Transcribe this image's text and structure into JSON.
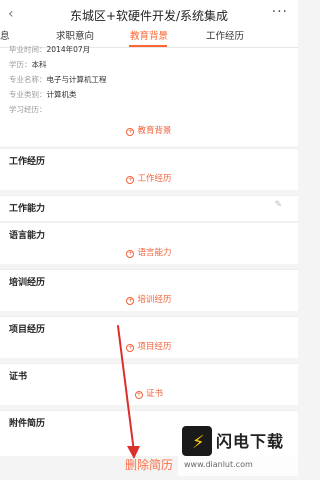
{
  "header": {
    "back_icon": "chevron-left",
    "title": "东城区+软硬件开发/系统集成",
    "more_icon": "more-dots"
  },
  "tabs": [
    {
      "label": "息",
      "active": false
    },
    {
      "label": "求职意向",
      "active": false
    },
    {
      "label": "教育背景",
      "active": true
    },
    {
      "label": "工作经历",
      "active": false
    }
  ],
  "education": {
    "rows": [
      {
        "label": "毕业时间：",
        "value": "2014年07月"
      },
      {
        "label": "学历：",
        "value": "本科"
      },
      {
        "label": "专业名称：",
        "value": "电子与计算机工程"
      },
      {
        "label": "专业类别：",
        "value": "计算机类"
      },
      {
        "label": "学习经历：",
        "value": ""
      }
    ],
    "add_label": "教育背景"
  },
  "sections": [
    {
      "title": "工作经历",
      "add_label": "工作经历"
    },
    {
      "title": "工作能力",
      "add_label": "",
      "edit_icon": "edit-icon"
    },
    {
      "title": "语言能力",
      "add_label": "语言能力"
    },
    {
      "title": "培训经历",
      "add_label": "培训经历"
    },
    {
      "title": "项目经历",
      "add_label": "项目经历"
    },
    {
      "title": "证书",
      "add_label": "证书"
    },
    {
      "title": "附件简历",
      "add_label": ""
    }
  ],
  "delete_label": "删除简历",
  "watermark": {
    "name": "闪电下载",
    "url": "www.dianlut.com"
  },
  "colors": {
    "accent": "#ff6633",
    "annotation_arrow": "#d9302c"
  }
}
